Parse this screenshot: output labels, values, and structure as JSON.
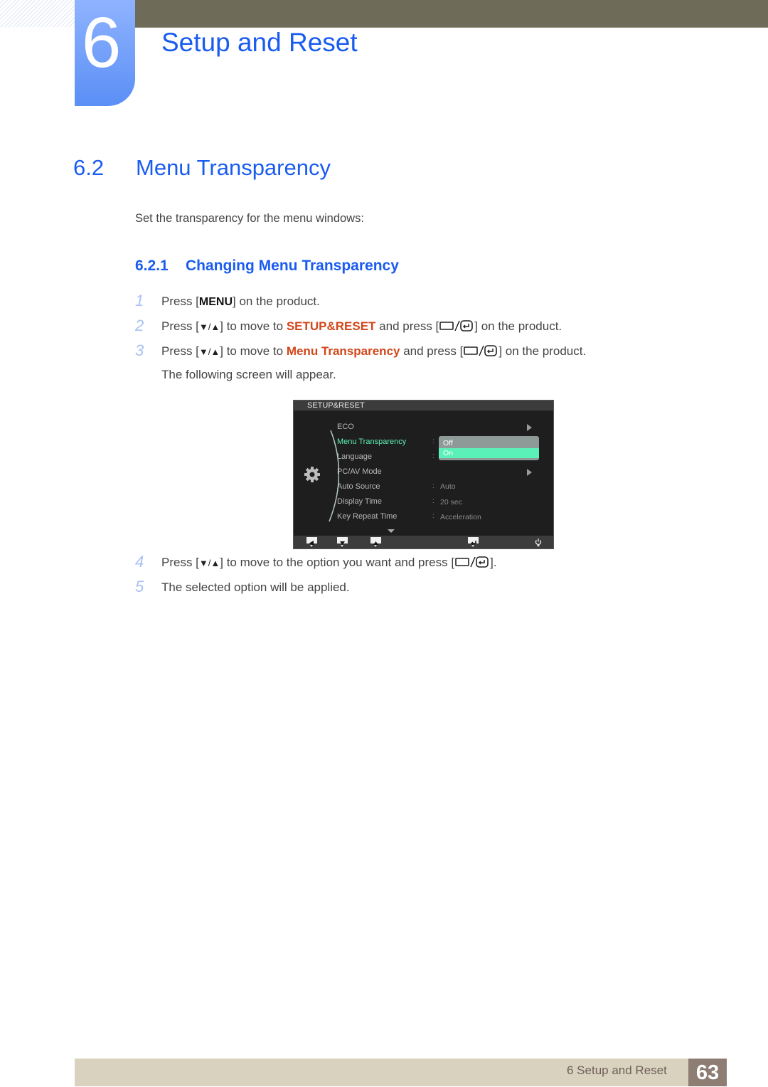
{
  "header": {
    "chapter_number": "6",
    "chapter_title": "Setup and Reset"
  },
  "section": {
    "number": "6.2",
    "title": "Menu Transparency",
    "intro": "Set the transparency for the menu windows:"
  },
  "subsection": {
    "number": "6.2.1",
    "title": "Changing Menu Transparency"
  },
  "steps": [
    {
      "num": "1",
      "pre": "Press [",
      "key": "MENU",
      "post": "] on the product."
    },
    {
      "num": "2",
      "pre": "Press [",
      "key": "▼/▲",
      "mid": "] to move to ",
      "highlight": "SETUP&RESET",
      "mid2": " and press [",
      "post": "] on the product."
    },
    {
      "num": "3",
      "pre": "Press [",
      "key": "▼/▲",
      "mid": "] to move to ",
      "highlight": "Menu Transparency",
      "mid2": " and press [",
      "post": "] on the product.",
      "note": "The following screen will appear."
    },
    {
      "num": "4",
      "pre": "Press [",
      "key": "▼/▲",
      "mid": "] to move to the option you want and press [",
      "post": "]."
    },
    {
      "num": "5",
      "text": "The selected option will be applied."
    }
  ],
  "osd": {
    "title": "SETUP&RESET",
    "items": [
      {
        "label": "ECO",
        "has_submenu": true
      },
      {
        "label": "Menu Transparency",
        "active": true
      },
      {
        "label": "Language"
      },
      {
        "label": "PC/AV Mode",
        "has_submenu": true
      },
      {
        "label": "Auto Source",
        "value": "Auto"
      },
      {
        "label": "Display Time",
        "value": "20 sec"
      },
      {
        "label": "Key Repeat Time",
        "value": "Acceleration"
      }
    ],
    "colon": ":",
    "dropdown": {
      "options": [
        "Off",
        "On"
      ],
      "selected": "On"
    },
    "footer_buttons": [
      "left-icon",
      "down-icon",
      "up-icon",
      "enter-icon",
      "power-icon"
    ],
    "colors": {
      "active": "#5ef0b5",
      "selected_option": "#5cf0b9"
    }
  },
  "footer": {
    "chapter_label": "6 Setup and Reset",
    "page_number": "63"
  },
  "colors": {
    "heading_blue": "#1a5cf0",
    "highlight_orange": "#d2461a",
    "step_number": "#a9c1f2"
  }
}
